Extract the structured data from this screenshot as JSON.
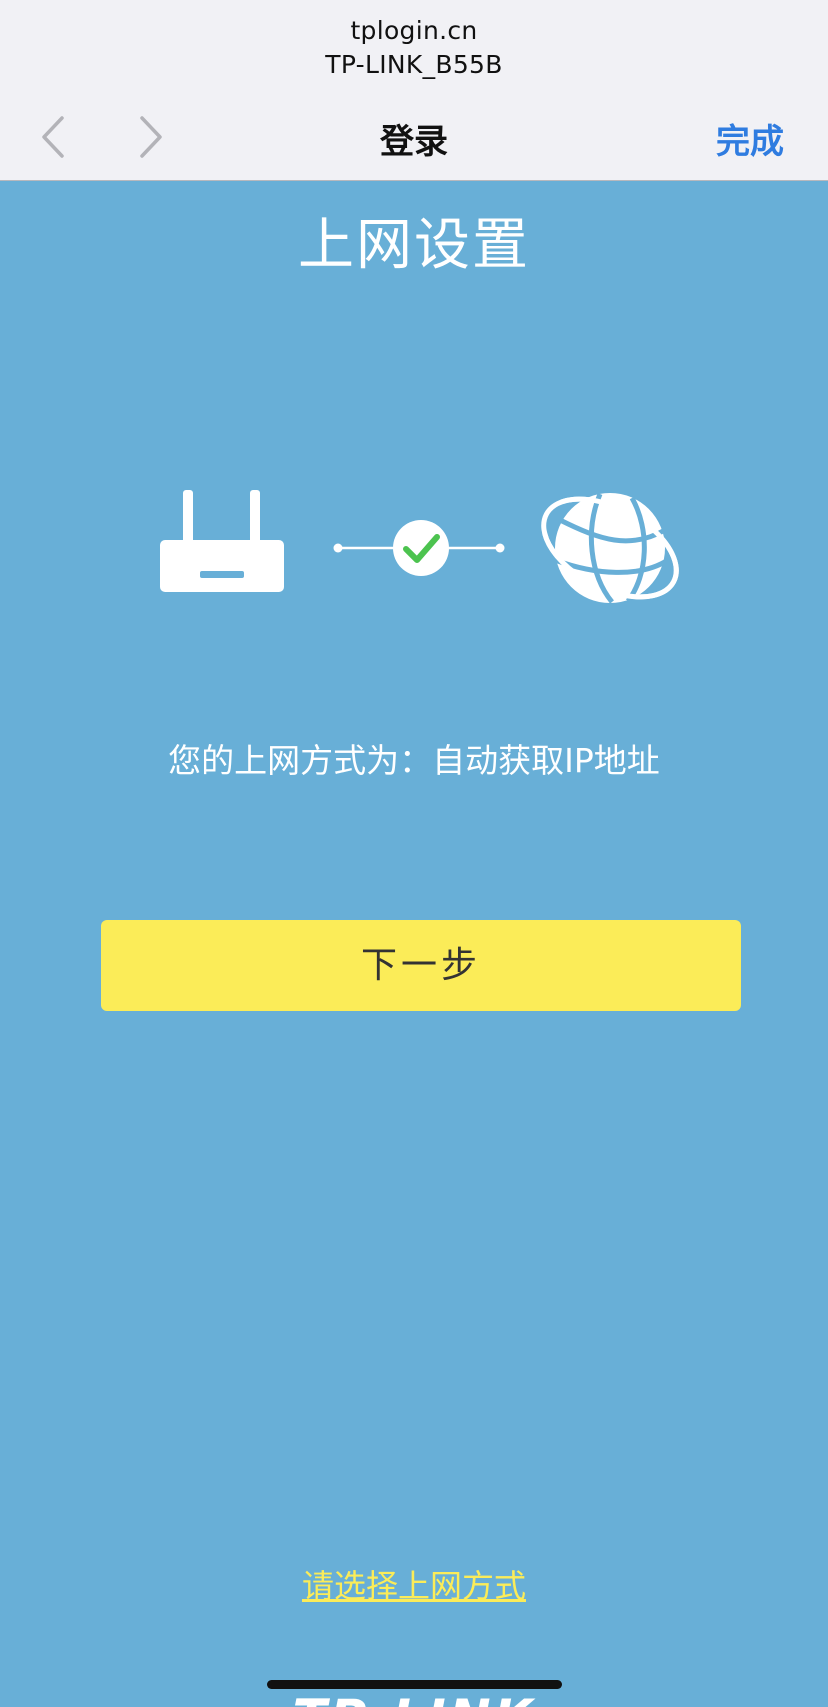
{
  "browser": {
    "host": "tplogin.cn",
    "network_name": "TP-LINK_B55B",
    "title": "登录",
    "done_label": "完成"
  },
  "page": {
    "title": "上网设置",
    "status_text": "您的上网方式为：自动获取IP地址",
    "next_button_label": "下一步",
    "choose_link_label": "请选择上网方式",
    "footer_logo": "TP-LINK"
  },
  "icons": {
    "router": "router-icon",
    "connected": "check-circle-icon",
    "internet": "globe-icon"
  },
  "colors": {
    "background": "#68afd7",
    "button": "#fbec58",
    "link": "#fbec58",
    "done": "#2f7ce0",
    "check": "#4cc34f"
  }
}
